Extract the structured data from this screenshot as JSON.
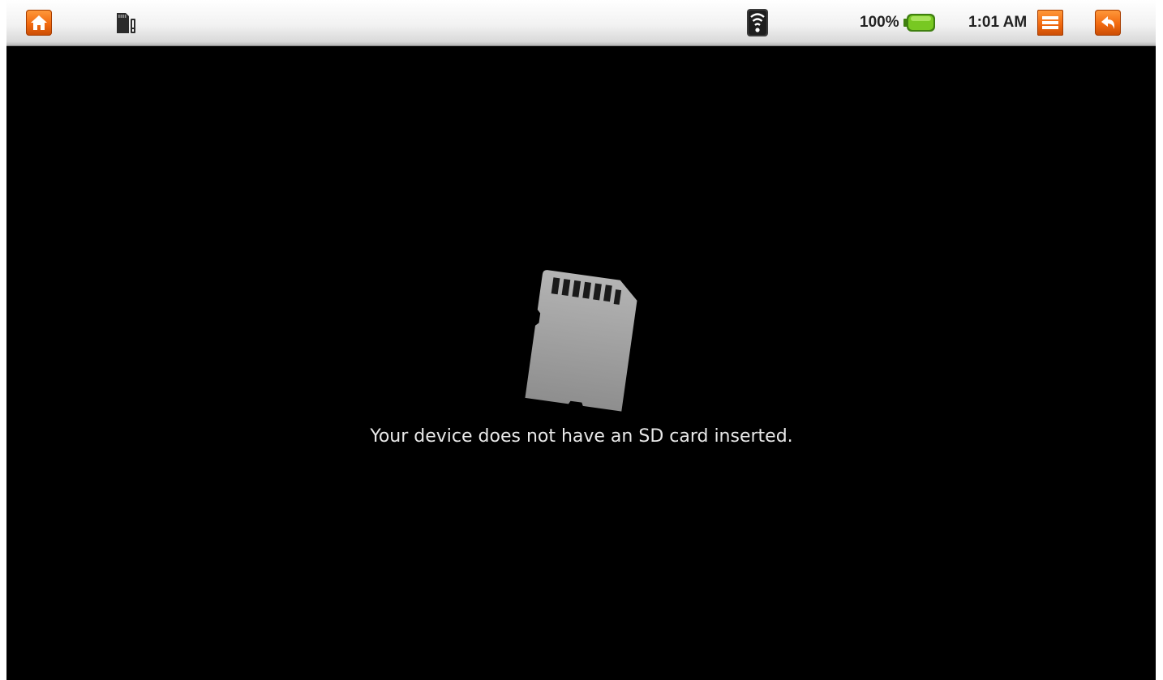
{
  "statusbar": {
    "left_icons": [
      "home-icon",
      "sd-card-alert-icon"
    ],
    "right_icons": [
      "wifi-icon",
      "battery-icon",
      "menu-icon",
      "back-icon"
    ],
    "battery_percent": "100%",
    "time": "1:01 AM"
  },
  "main": {
    "icon": "sd-card-icon",
    "message": "Your device does not have an SD card inserted."
  },
  "colors": {
    "statusbar_bg": "#f0f0f0",
    "screen_bg": "#000000",
    "button_orange": "#f26a10",
    "battery_green": "#6abf1a",
    "message_text": "#e8e8e8"
  }
}
